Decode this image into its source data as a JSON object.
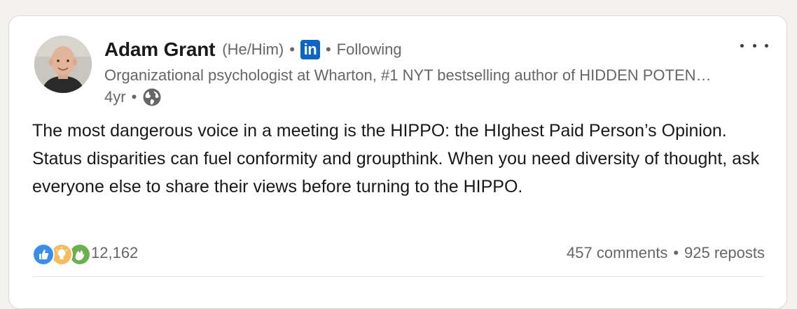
{
  "post": {
    "author": {
      "name": "Adam Grant",
      "pronouns": "(He/Him)",
      "separator": "•",
      "badge": "in",
      "follow_status": "Following",
      "headline": "Organizational psychologist at Wharton, #1 NYT bestselling author of HIDDEN POTENTIAL, host of the TED podcast ReThinking"
    },
    "meta": {
      "time": "4yr",
      "separator": "•",
      "visibility_icon": "globe-icon"
    },
    "body": {
      "line1": "The most dangerous voice in a meeting is the HIPPO: the HIghest Paid Person’s Opinion.",
      "line2": "Status disparities can fuel conformity and groupthink. When you need diversity of thought, ask everyone else to share their views before turning to the HIPPO."
    },
    "social": {
      "reaction_icons": [
        "like-icon",
        "insightful-icon",
        "celebrate-icon"
      ],
      "reaction_count": "12,162",
      "comments": "457 comments",
      "separator": "•",
      "reposts": "925 reposts"
    },
    "colors": {
      "linkedin_blue": "#0a66c2",
      "like": "#378fe9",
      "insightful": "#f5bb5c",
      "celebrate": "#6dae4f",
      "secondary_text": "#666666"
    }
  }
}
